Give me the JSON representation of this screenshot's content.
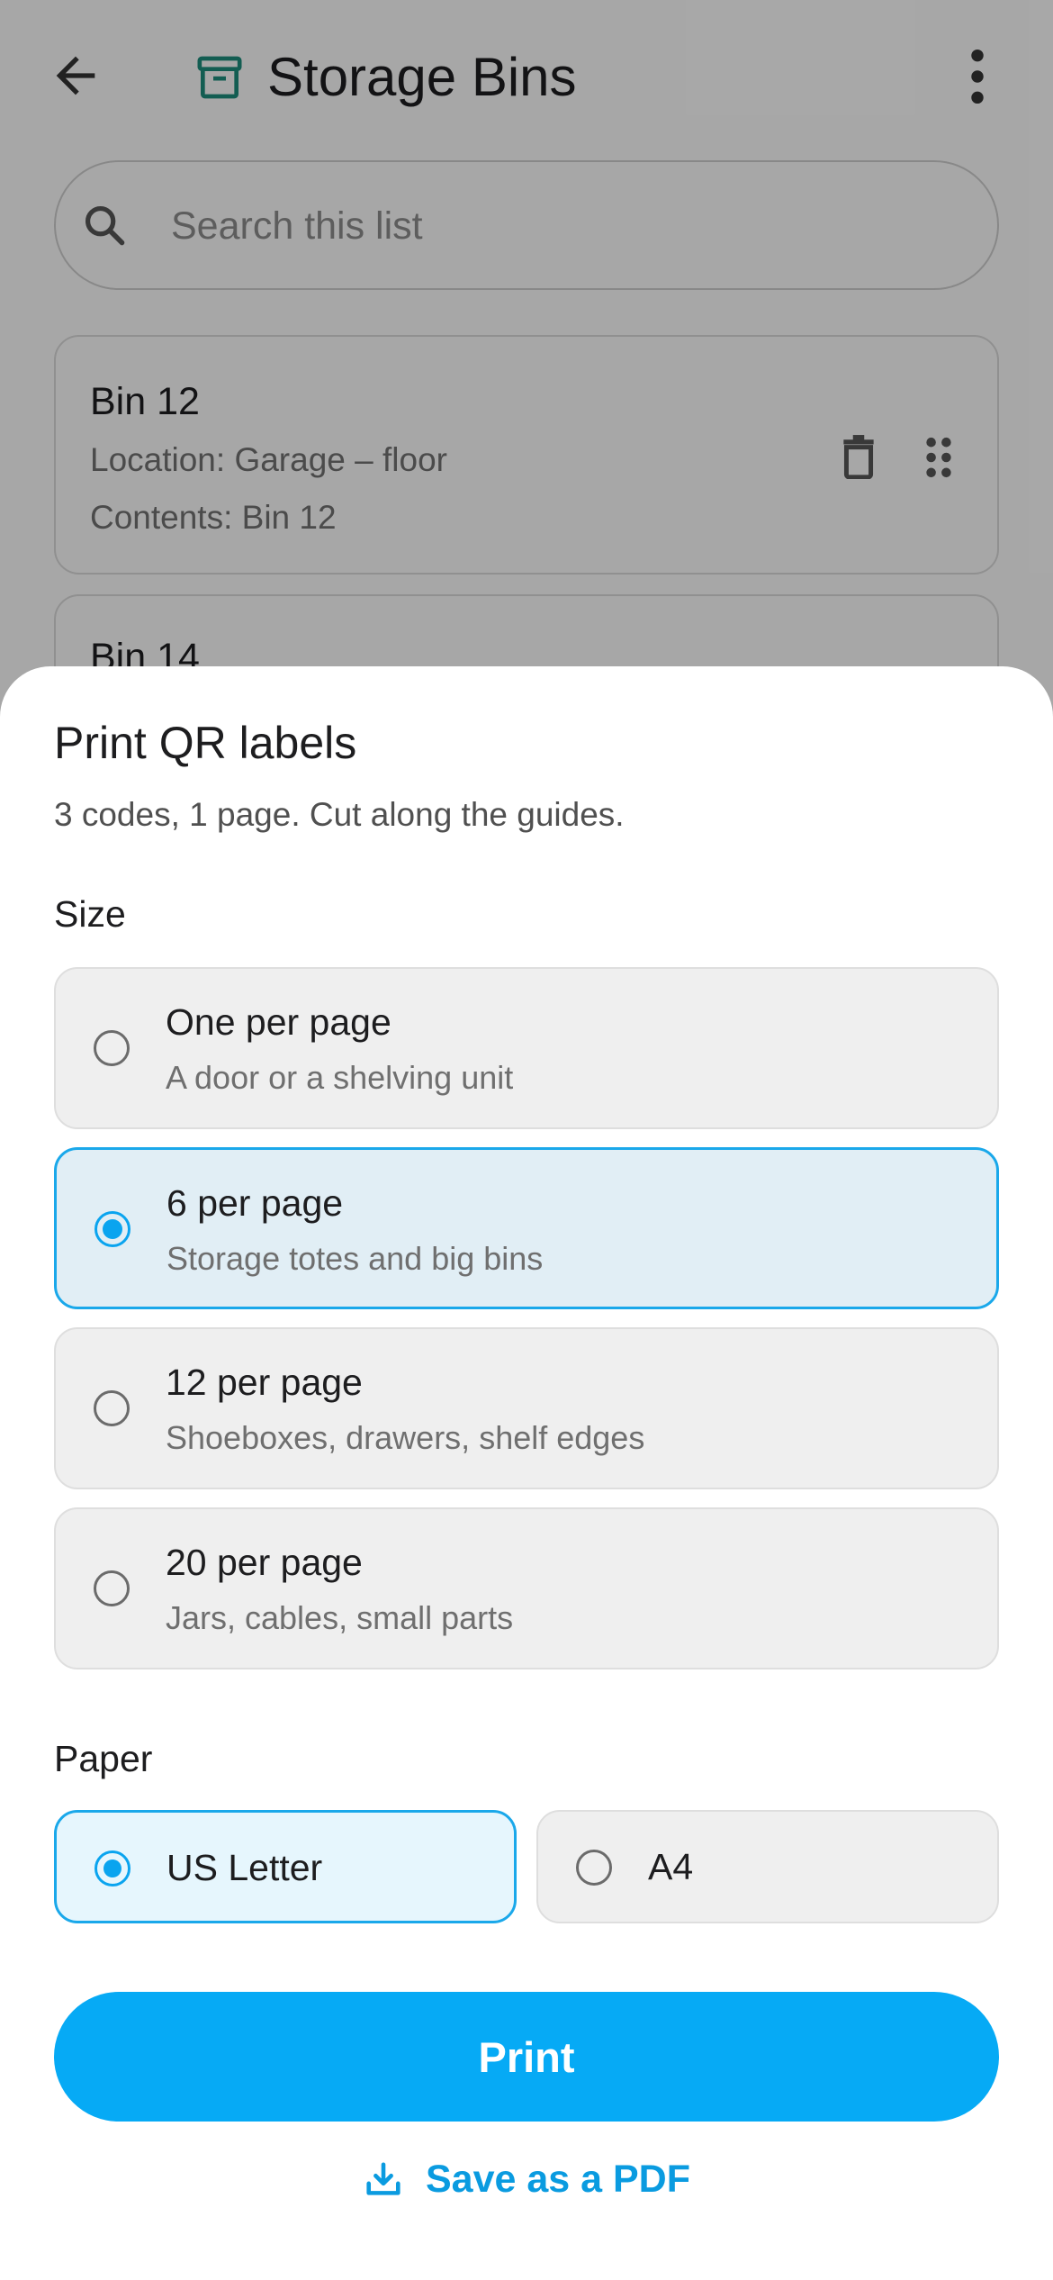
{
  "header": {
    "title": "Storage Bins",
    "icons": {
      "back": "arrow-left-icon",
      "title": "archive-box-icon",
      "more": "more-vertical-icon"
    }
  },
  "search": {
    "placeholder": "Search this list",
    "value": ""
  },
  "list": [
    {
      "title": "Bin 12",
      "location": "Location: Garage – floor",
      "contents": "Contents: Bin 12"
    },
    {
      "title": "Bin 14"
    }
  ],
  "sheet": {
    "title": "Print QR labels",
    "subtitle": "3 codes, 1 page. Cut along the guides.",
    "size_label": "Size",
    "size_options": [
      {
        "title": "One per page",
        "description": "A door or a shelving unit",
        "selected": false
      },
      {
        "title": "6 per page",
        "description": "Storage totes and big bins",
        "selected": true
      },
      {
        "title": "12 per page",
        "description": "Shoeboxes, drawers, shelf edges",
        "selected": false
      },
      {
        "title": "20 per page",
        "description": "Jars, cables, small parts",
        "selected": false
      }
    ],
    "paper_label": "Paper",
    "paper_options": [
      {
        "label": "US Letter",
        "selected": true
      },
      {
        "label": "A4",
        "selected": false
      }
    ],
    "print_button": "Print",
    "pdf_link": "Save as a PDF"
  },
  "colors": {
    "accent": "#06aaf5",
    "selected_bg": "#e1eef5",
    "title_icon": "#1c8a7a"
  }
}
